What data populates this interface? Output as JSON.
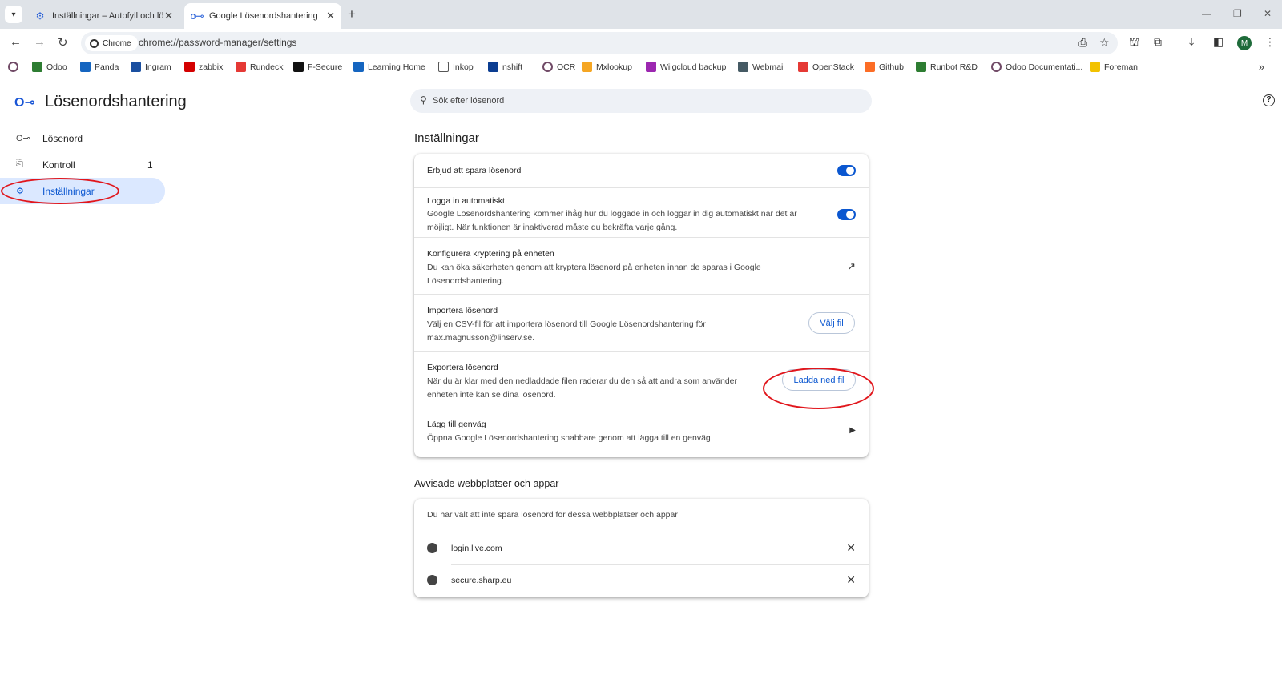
{
  "browser": {
    "tabs": [
      {
        "title": "Inställningar – Autofyll och lösenord",
        "icon": "gear-icon",
        "active": false
      },
      {
        "title": "Google Lösenordshantering",
        "icon": "key-icon",
        "active": true
      }
    ],
    "chip_label": "Chrome",
    "url": "chrome://password-manager/settings",
    "avatar_initial": "M"
  },
  "bookmarks": [
    {
      "label": "",
      "icon": "odoo-circle-icon",
      "color": "#714b67"
    },
    {
      "label": "Odoo",
      "icon": "odoo-icon",
      "color": "#2e7d32"
    },
    {
      "label": "Panda",
      "icon": "panda-icon",
      "color": "#1565c0"
    },
    {
      "label": "Ingram",
      "icon": "ingram-icon",
      "color": "#1a4fa0"
    },
    {
      "label": "zabbix",
      "icon": "zabbix-icon",
      "color": "#d40000"
    },
    {
      "label": "Rundeck",
      "icon": "rundeck-icon",
      "color": "#e53935"
    },
    {
      "label": "F-Secure",
      "icon": "fsecure-icon",
      "color": "#111111"
    },
    {
      "label": "Learning Home",
      "icon": "salesforce-icon",
      "color": "#1565c0"
    },
    {
      "label": "Inkop",
      "icon": "folder-icon",
      "color": "#555555"
    },
    {
      "label": "nshift",
      "icon": "nshift-icon",
      "color": "#0b3d91"
    },
    {
      "label": "OCR",
      "icon": "odoo-circle-icon",
      "color": "#714b67"
    },
    {
      "label": "Mxlookup",
      "icon": "mxlookup-icon",
      "color": "#f5a623"
    },
    {
      "label": "Wiigcloud backup",
      "icon": "cloud-icon",
      "color": "#9c27b0"
    },
    {
      "label": "Webmail",
      "icon": "webmail-icon",
      "color": "#455a64"
    },
    {
      "label": "OpenStack",
      "icon": "openstack-icon",
      "color": "#e53935"
    },
    {
      "label": "Github",
      "icon": "gitlab-icon",
      "color": "#fc6d26"
    },
    {
      "label": "Runbot R&D",
      "icon": "runbot-icon",
      "color": "#2e7d32"
    },
    {
      "label": "Odoo Documentati...",
      "icon": "odoo-circle-icon",
      "color": "#714b67"
    },
    {
      "label": "Foreman",
      "icon": "foreman-icon",
      "color": "#f2c200"
    }
  ],
  "app": {
    "title": "Lösenordshantering",
    "search_placeholder": "Sök efter lösenord"
  },
  "sidebar": {
    "items": [
      {
        "label": "Lösenord",
        "icon": "key-icon",
        "badge": ""
      },
      {
        "label": "Kontroll",
        "icon": "checkup-icon",
        "badge": "1"
      },
      {
        "label": "Inställningar",
        "icon": "gear-icon",
        "badge": "",
        "active": true
      }
    ]
  },
  "settings": {
    "heading": "Inställningar",
    "offer_save": {
      "label": "Erbjud att spara lösenord",
      "enabled": true
    },
    "auto_signin": {
      "label": "Logga in automatiskt",
      "desc": "Google Lösenordshantering kommer ihåg hur du loggade in och loggar in dig automatiskt när det är möjligt. När funktionen är inaktiverad måste du bekräfta varje gång.",
      "enabled": true
    },
    "encryption": {
      "label": "Konfigurera kryptering på enheten",
      "desc": "Du kan öka säkerheten genom att kryptera lösenord på enheten innan de sparas i Google Lösenordshantering."
    },
    "import": {
      "label": "Importera lösenord",
      "desc": "Välj en CSV-fil för att importera lösenord till Google Lösenordshantering för max.magnusson@linserv.se.",
      "button": "Välj fil"
    },
    "export": {
      "label": "Exportera lösenord",
      "desc": "När du är klar med den nedladdade filen raderar du den så att andra som använder enheten inte kan se dina lösenord.",
      "button": "Ladda ned fil"
    },
    "shortcut": {
      "label": "Lägg till genväg",
      "desc": "Öppna Google Lösenordshantering snabbare genom att lägga till en genväg"
    }
  },
  "rejected": {
    "heading": "Avvisade webbplatser och appar",
    "intro": "Du har valt att inte spara lösenord för dessa webbplatser och appar",
    "sites": [
      "login.live.com",
      "secure.sharp.eu"
    ]
  },
  "accent_color": "#0b57d0",
  "annotation_color": "#e1161c"
}
